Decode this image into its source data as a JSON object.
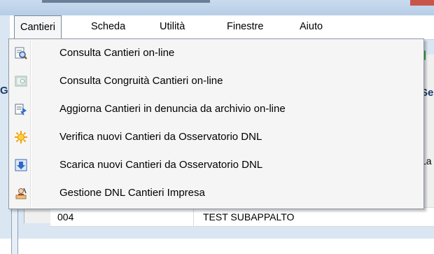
{
  "menubar": {
    "items": [
      {
        "label": "Cantieri",
        "active": true
      },
      {
        "label": "Scheda"
      },
      {
        "label": "Utilità"
      },
      {
        "label": "Finestre"
      },
      {
        "label": "Aiuto"
      }
    ]
  },
  "dropdown": {
    "items": [
      {
        "label": "Consulta Cantieri on-line",
        "icon": "consult-icon"
      },
      {
        "label": "Consulta Congruità Cantieri on-line",
        "icon": "congruity-icon"
      },
      {
        "label": "Aggiorna Cantieri in denuncia da archivio on-line",
        "icon": "update-icon"
      },
      {
        "label": "Verifica nuovi Cantieri da Osservatorio DNL",
        "icon": "sun-icon"
      },
      {
        "label": "Scarica nuovi Cantieri da Osservatorio DNL",
        "icon": "download-icon"
      },
      {
        "label": "Gestione DNL Cantieri Impresa",
        "icon": "manage-icon"
      }
    ]
  },
  "background": {
    "left_peek": "G",
    "right_peek_heading": "Se",
    "right_peek_column": "La",
    "row": {
      "code": "004",
      "name": "TEST SUBAPPALTO"
    }
  }
}
